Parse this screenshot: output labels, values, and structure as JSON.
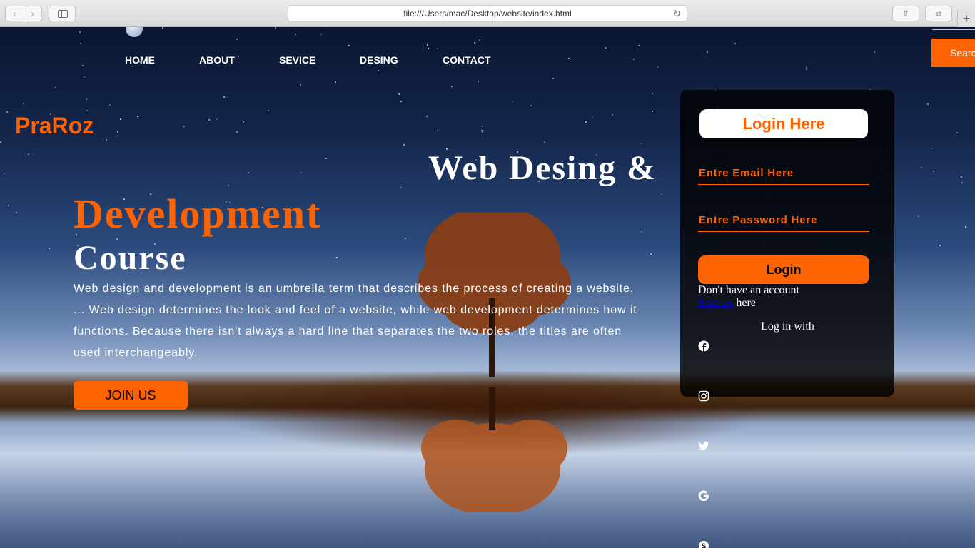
{
  "browser": {
    "url": "file:///Users/mac/Desktop/website/index.html"
  },
  "nav": {
    "items": [
      "HOME",
      "ABOUT",
      "SEVICE",
      "DESING",
      "CONTACT"
    ]
  },
  "search": {
    "label": "Search"
  },
  "brand": {
    "logo": "PraRoz"
  },
  "hero": {
    "line1": "Web Desing &",
    "line2": "Development",
    "line3": "Course",
    "description": "Web design and development is an umbrella term that describes the process of creating a website. ... Web design determines the look and feel of a website, while web development determines how it functions. Because there isn't always a hard line that separates the two roles, the titles are often used interchangeably.",
    "cta": "JOIN US"
  },
  "login": {
    "title": "Login Here",
    "email_placeholder": "Entre Email Here",
    "password_placeholder": "Entre Password Here",
    "button": "Login",
    "no_account": "Don't have an account",
    "signup_link": "Sign up",
    "signup_suffix": " here",
    "login_with": "Log in with"
  },
  "social_icons": [
    "facebook-icon",
    "instagram-icon",
    "twitter-icon",
    "google-icon",
    "skype-icon"
  ],
  "colors": {
    "accent": "#ff6300",
    "panel": "#000000",
    "text": "#ffffff",
    "link": "#0000ee"
  }
}
